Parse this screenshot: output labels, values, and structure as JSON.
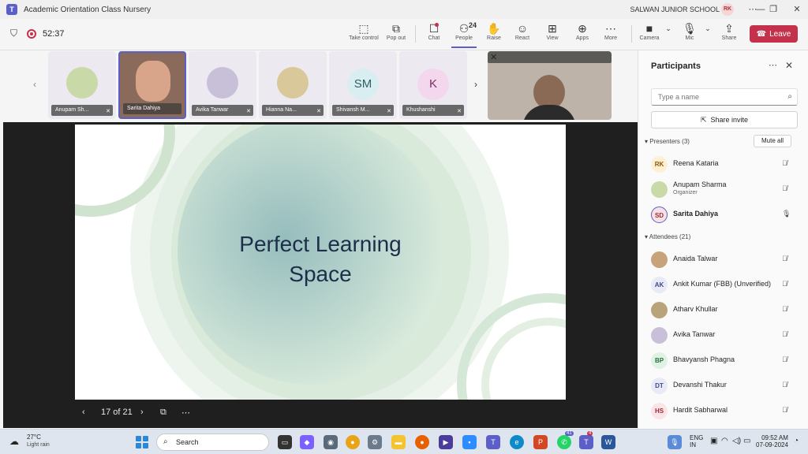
{
  "window": {
    "title": "Academic Orientation Class Nursery",
    "org": "SALWAN JUNIOR SCHOOL",
    "org_initials": "RK"
  },
  "toolbar": {
    "timer": "52:37",
    "buttons": [
      {
        "label": "Take control",
        "icon": "take-control-icon"
      },
      {
        "label": "Pop out",
        "icon": "pop-out-icon"
      },
      {
        "label": "Chat",
        "icon": "chat-icon"
      },
      {
        "label": "People",
        "icon": "people-icon",
        "count": "24"
      },
      {
        "label": "Raise",
        "icon": "raise-hand-icon"
      },
      {
        "label": "React",
        "icon": "react-icon"
      },
      {
        "label": "View",
        "icon": "view-icon"
      },
      {
        "label": "Apps",
        "icon": "apps-icon"
      },
      {
        "label": "More",
        "icon": "more-icon"
      },
      {
        "label": "Camera",
        "icon": "camera-icon"
      },
      {
        "label": "Mic",
        "icon": "mic-off-icon"
      },
      {
        "label": "Share",
        "icon": "share-icon"
      }
    ],
    "leave_label": "Leave"
  },
  "gallery": {
    "tiles": [
      {
        "name": "Anupam Sh...",
        "kind": "photo",
        "color": "#c9d9a8"
      },
      {
        "name": "Sarita Dahiya",
        "kind": "video",
        "color": "#8a6a5a"
      },
      {
        "name": "Avika Tanwar",
        "kind": "photo",
        "color": "#c8c0d8"
      },
      {
        "name": "Hianna Na...",
        "kind": "photo",
        "color": "#d8c89a"
      },
      {
        "name": "Shivansh M...",
        "kind": "initials",
        "initials": "SM",
        "color": "#d9eef0",
        "text_color": "#2f5f66"
      },
      {
        "name": "Khushanshi",
        "kind": "initials",
        "initials": "K",
        "color": "#f3d7ec",
        "text_color": "#7a2e6a"
      }
    ]
  },
  "slide": {
    "title_line1": "Perfect Learning",
    "title_line2": "Space",
    "counter": "17 of 21"
  },
  "participants": {
    "title": "Participants",
    "search_placeholder": "Type a name",
    "share_invite": "Share invite",
    "presenters_label": "Presenters (3)",
    "mute_all": "Mute all",
    "attendees_label": "Attendees (21)",
    "presenters": [
      {
        "initials": "RK",
        "name": "Reena Kataria",
        "role": "",
        "mic": "off",
        "bg": "#fdf0d5",
        "fg": "#8a5a00"
      },
      {
        "initials": "",
        "name": "Anupam Sharma",
        "role": "Organizer",
        "mic": "off",
        "bg": "#c9d9a8",
        "fg": "#333"
      },
      {
        "initials": "SD",
        "name": "Sarita Dahiya",
        "role": "",
        "mic": "on",
        "bg": "#f8e1e4",
        "fg": "#9b2c3c"
      }
    ],
    "attendees": [
      {
        "initials": "",
        "name": "Anaida Talwar",
        "mic": "off",
        "bg": "#c7a27a",
        "fg": "#333"
      },
      {
        "initials": "AK",
        "name": "Ankit Kumar (FBB) (Unverified)",
        "mic": "off",
        "bg": "#e8ebf7",
        "fg": "#404b8a"
      },
      {
        "initials": "",
        "name": "Atharv Khullar",
        "mic": "off",
        "bg": "#b9a37a",
        "fg": "#333"
      },
      {
        "initials": "",
        "name": "Avika Tanwar",
        "mic": "off",
        "bg": "#c8c0d8",
        "fg": "#333"
      },
      {
        "initials": "BP",
        "name": "Bhavyansh Phagna",
        "mic": "off",
        "bg": "#dff3e4",
        "fg": "#2b6e3b"
      },
      {
        "initials": "DT",
        "name": "Devanshi Thakur",
        "mic": "off",
        "bg": "#e8ebf7",
        "fg": "#404b8a"
      },
      {
        "initials": "HS",
        "name": "Hardit Sabharwal",
        "mic": "off",
        "bg": "#fbe4e6",
        "fg": "#9b2c3c"
      }
    ]
  },
  "taskbar": {
    "temperature": "27°C",
    "weather": "Light rain",
    "search_label": "Search",
    "language_line1": "ENG",
    "language_line2": "IN",
    "time": "09:52 AM",
    "date": "07-09-2024",
    "whatsapp_badge": "41",
    "teams_badge": "4"
  }
}
